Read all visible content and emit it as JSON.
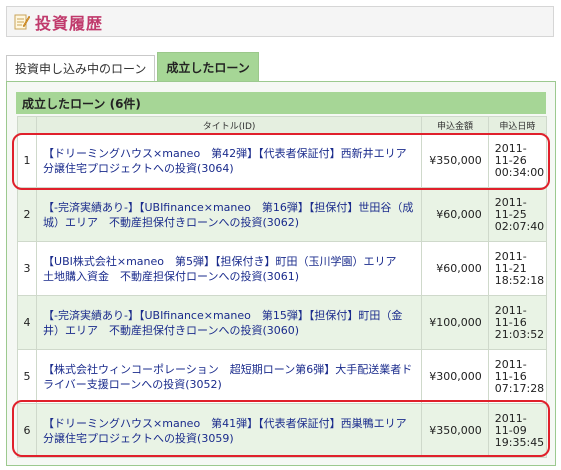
{
  "header": {
    "title": "投資履歴"
  },
  "tabs": [
    {
      "label": "投資申し込み中のローン",
      "active": false
    },
    {
      "label": "成立したローン",
      "active": true
    }
  ],
  "section": {
    "title": "成立したローン (6件)"
  },
  "table": {
    "headers": {
      "title": "タイトル(ID)",
      "amount": "申込金額",
      "date": "申込日時"
    },
    "rows": [
      {
        "num": "1",
        "title": "【ドリーミングハウス×maneo　第42弾】【代表者保証付】西新井エリア　分譲住宅プロジェクトへの投資(3064)",
        "amount": "¥350,000",
        "date1": "2011-",
        "date2": "11-26",
        "date3": "00:34:00"
      },
      {
        "num": "2",
        "title": "【-完済実績あり-】【UBIfinance×maneo　第16弾】【担保付】世田谷（成城）エリア　不動産担保付きローンへの投資(3062)",
        "amount": "¥60,000",
        "date1": "2011-",
        "date2": "11-25",
        "date3": "02:07:40"
      },
      {
        "num": "3",
        "title": "【UBI株式会社×maneo　第5弾】【担保付き】町田（玉川学園）エリア　土地購入資金　不動産担保付ローンへの投資(3061)",
        "amount": "¥60,000",
        "date1": "2011-",
        "date2": "11-21",
        "date3": "18:52:18"
      },
      {
        "num": "4",
        "title": "【-完済実績あり-】【UBIfinance×maneo　第15弾】【担保付】町田（金井）エリア　不動産担保付きローンへの投資(3060)",
        "amount": "¥100,000",
        "date1": "2011-",
        "date2": "11-16",
        "date3": "21:03:52"
      },
      {
        "num": "5",
        "title": "【株式会社ウィンコーポレーション　超短期ローン第6弾】大手配送業者ドライバー支援ローンへの投資(3052)",
        "amount": "¥300,000",
        "date1": "2011-",
        "date2": "11-16",
        "date3": "07:17:28"
      },
      {
        "num": "6",
        "title": "【ドリーミングハウス×maneo　第41弾】【代表者保証付】西巣鴨エリア　分譲住宅プロジェクトへの投資(3059)",
        "amount": "¥350,000",
        "date1": "2011-",
        "date2": "11-09",
        "date3": "19:35:45"
      }
    ]
  },
  "colors": {
    "accent": "#c03a6c",
    "tab_active": "#a6d696",
    "highlight": "#e0202b",
    "link": "#1a2b8c"
  },
  "icons": {
    "header_icon": "memo-pencil-icon"
  }
}
